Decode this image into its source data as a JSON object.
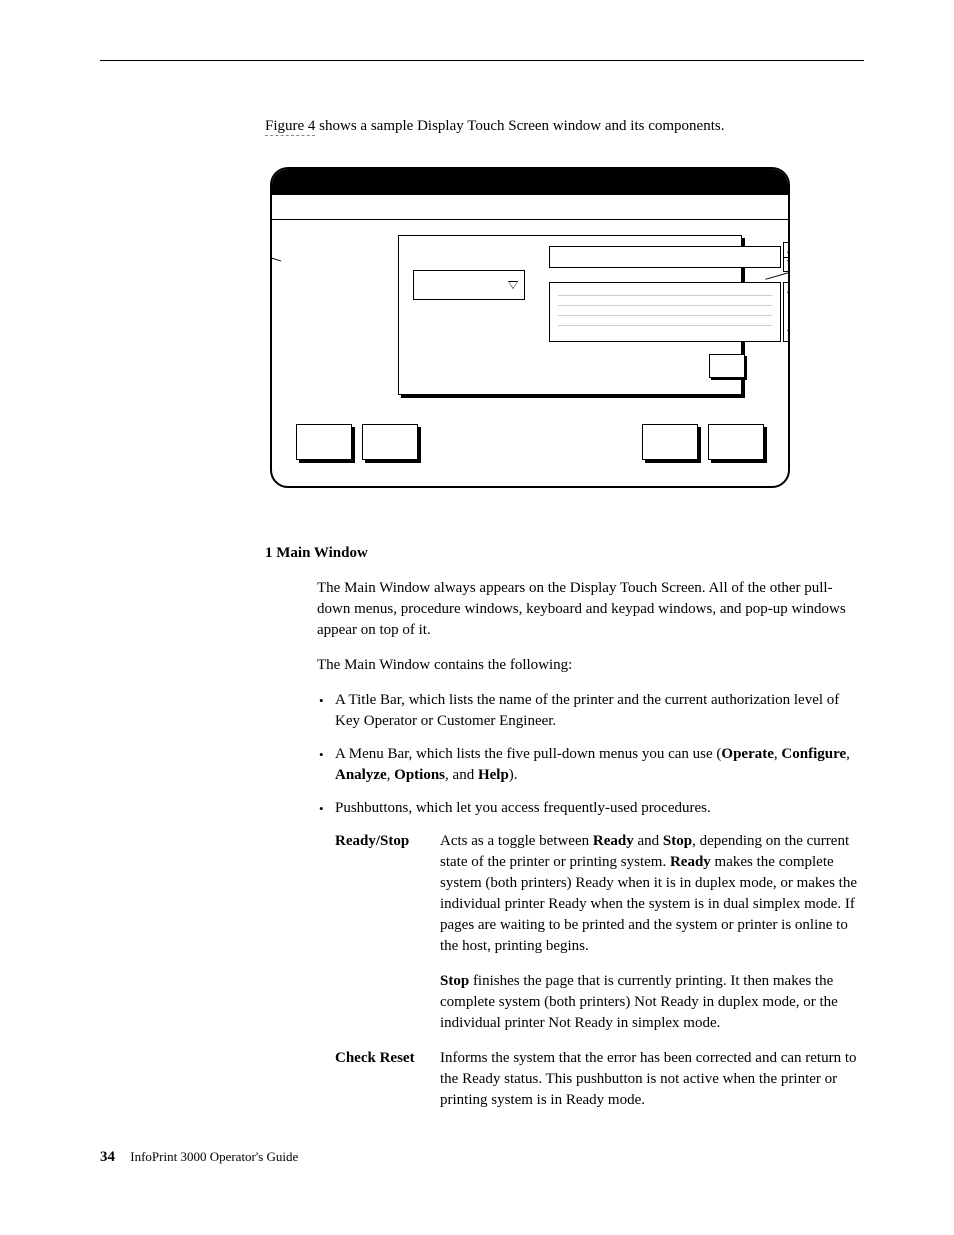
{
  "intro": {
    "link_text": "Figure 4",
    "rest": " shows a sample Display Touch Screen window and its components."
  },
  "section": {
    "heading": "1 Main Window",
    "para1": "The Main Window always appears on the Display Touch Screen. All of the other pull-down menus, procedure windows, keyboard and keypad windows, and pop-up windows appear on top of it.",
    "para2": "The Main Window contains the following:",
    "bullets": {
      "b1": "A Title Bar, which lists the name of the printer and the current authorization level of Key Operator or Customer Engineer.",
      "b2_pre": "A Menu Bar, which lists the five pull-down menus you can use (",
      "b2_terms": [
        "Operate",
        "Configure",
        "Analyze",
        "Options",
        "Help"
      ],
      "b2_post": ").",
      "b3": "Pushbuttons, which let you access frequently-used procedures."
    },
    "defs": {
      "ready_stop": {
        "term": "Ready/Stop",
        "p1_pre": "Acts as a toggle between ",
        "p1_b1": "Ready",
        "p1_mid": " and ",
        "p1_b2": "Stop",
        "p1_post": ", depending on the current state of the printer or printing system. ",
        "p1_b3": "Ready",
        "p1_tail": " makes the complete system (both printers) Ready when it is in duplex mode, or makes the individual printer Ready when the system is in dual simplex mode. If pages are waiting to be printed and the system or printer is online to the host, printing begins.",
        "p2_b": "Stop",
        "p2_rest": " finishes the page that is currently printing. It then makes the complete system (both printers) Not Ready in duplex mode, or the individual printer Not Ready in simplex mode."
      },
      "check_reset": {
        "term": "Check Reset",
        "p": "Informs the system that the error has been corrected and can return to the Ready status. This pushbutton is not active when the printer or printing system is in Ready mode."
      }
    }
  },
  "footer": {
    "page": "34",
    "title": "InfoPrint 3000 Operator's Guide"
  }
}
